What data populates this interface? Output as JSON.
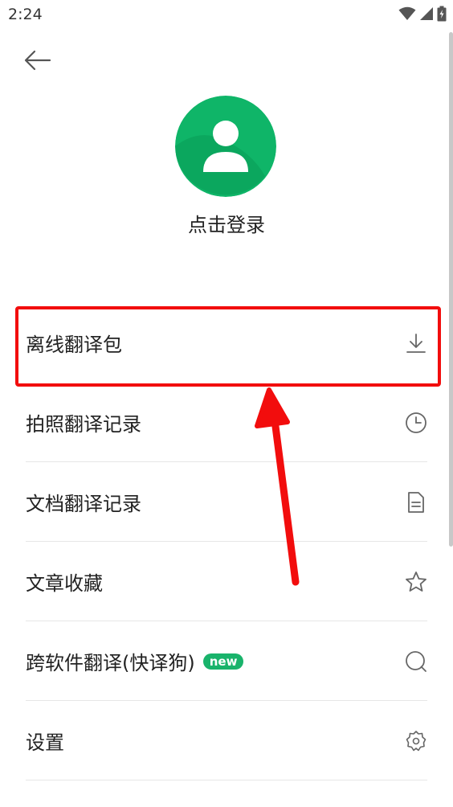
{
  "status_bar": {
    "time": "2:24",
    "icons": [
      "wifi-icon",
      "cellular-signal-icon",
      "battery-charging-icon"
    ]
  },
  "header": {
    "back_icon": "arrow-left-icon"
  },
  "profile": {
    "avatar_icon": "user-avatar-icon",
    "avatar_color": "#0fb568",
    "login_label": "点击登录"
  },
  "menu": {
    "items": [
      {
        "label": "离线翻译包",
        "icon": "download-icon"
      },
      {
        "label": "拍照翻译记录",
        "icon": "clock-icon"
      },
      {
        "label": "文档翻译记录",
        "icon": "document-icon"
      },
      {
        "label": "文章收藏",
        "icon": "star-icon"
      },
      {
        "label": "跨软件翻译(快译狗)",
        "badge": "new",
        "icon": "search-bubble-icon"
      },
      {
        "label": "设置",
        "icon": "gear-icon"
      }
    ]
  },
  "annotation": {
    "highlight_color": "#f20d0d",
    "arrow_color": "#f20d0d"
  }
}
